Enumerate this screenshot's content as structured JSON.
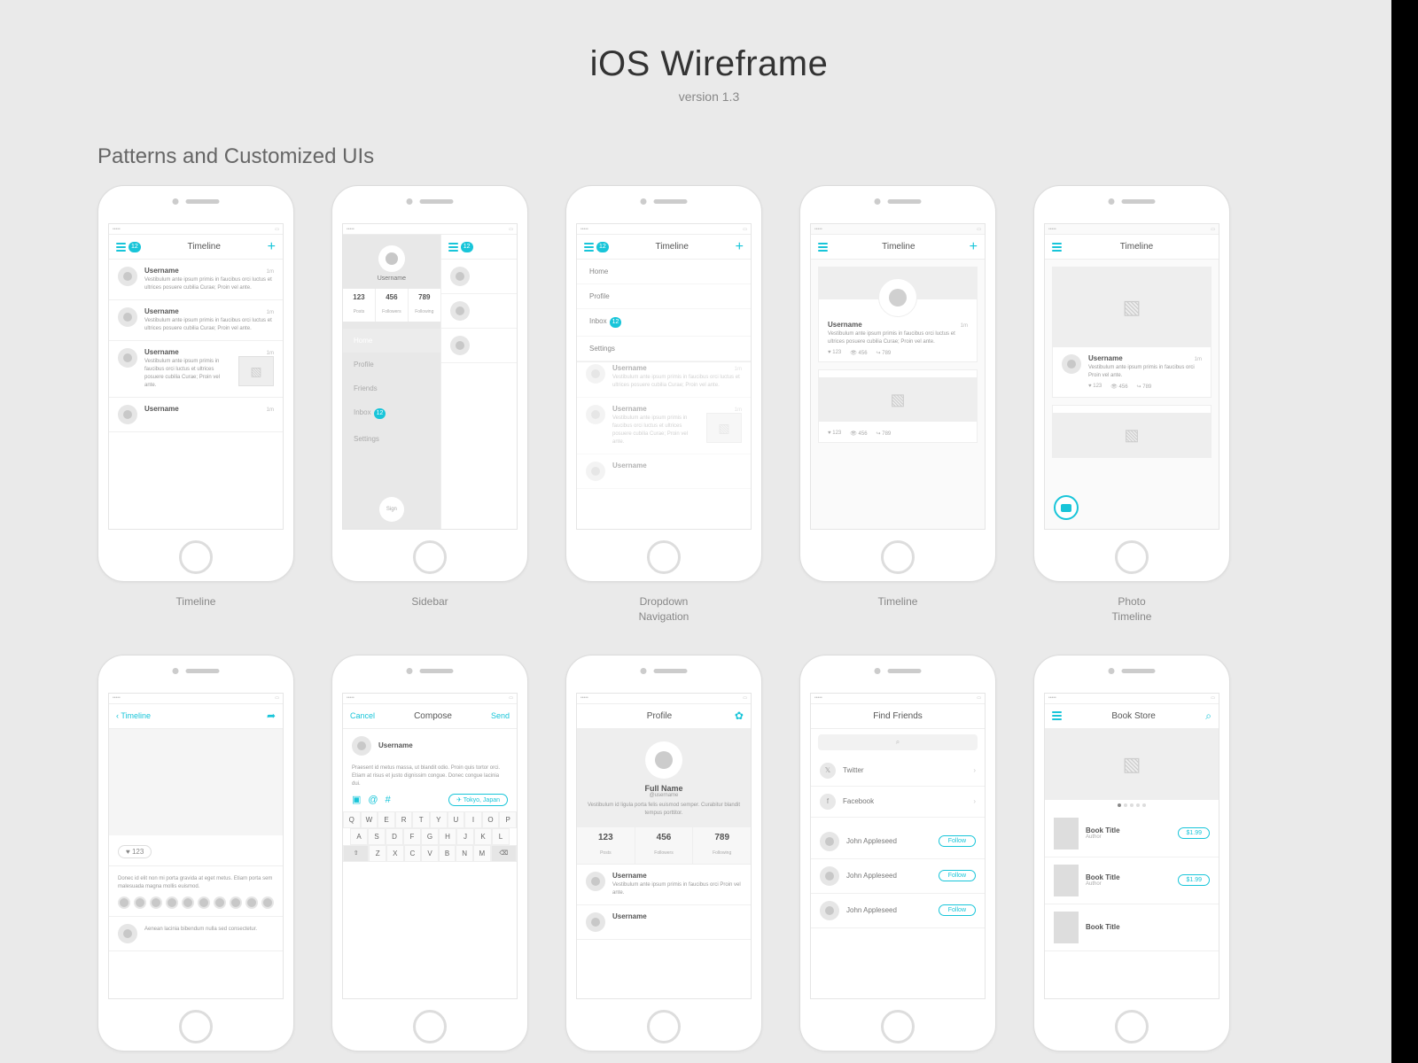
{
  "header": {
    "title": "iOS Wireframe",
    "version": "version 1.3",
    "section": "Patterns and Customized UIs"
  },
  "captions": [
    "Timeline",
    "Sidebar",
    "Dropdown\nNavigation",
    "Timeline",
    "Photo\nTimeline"
  ],
  "nav": {
    "timeline": "Timeline",
    "compose": "Compose",
    "profile": "Profile",
    "findfriends": "Find Friends",
    "bookstore": "Book Store",
    "cancel": "Cancel",
    "send": "Send",
    "searchGlyph": "⌕"
  },
  "badge": "12",
  "post": {
    "username": "Username",
    "time": "1m",
    "text": "Vestibulum ante ipsum primis in faucibus orci luctus et ultrices posuere cubilia Curae; Proin vel ante.",
    "text_short": "Vestibulum ante ipsum primis in faucibus orci Proin vel ante."
  },
  "sidebar": {
    "stats": [
      {
        "n": "123",
        "l": "Posts"
      },
      {
        "n": "456",
        "l": "Followers"
      },
      {
        "n": "789",
        "l": "Following"
      }
    ],
    "items": [
      "Home",
      "Profile",
      "Friends",
      "Inbox",
      "Settings"
    ],
    "inbox_badge": "12",
    "logout": "Sign"
  },
  "dropdown": {
    "items": [
      "Home",
      "Profile",
      "Inbox",
      "Settings"
    ],
    "inbox_badge": "12"
  },
  "card_stats": [
    "♥ 123",
    "👁 456",
    "↪ 789"
  ],
  "detail": {
    "back": "Timeline",
    "likes": "♥ 123",
    "comment1": "Donec id elit non mi porta gravida at eget metus. Etiam porta sem malesuada magna mollis euismod.",
    "comment2": "Aenean lacinia bibendum nulla sed consectetur.",
    "author2": "Username"
  },
  "compose": {
    "username": "Username",
    "text": "Praesent id metus massa, ut blandit odio. Proin quis tortor orci. Etiam at risus et justo dignissim congue. Donec congue lacinia dui.",
    "loc": "✈ Tokyo, Japan",
    "kb1": [
      "Q",
      "W",
      "E",
      "R",
      "T",
      "Y",
      "U",
      "I",
      "O",
      "P"
    ],
    "kb2": [
      "A",
      "S",
      "D",
      "F",
      "G",
      "H",
      "J",
      "K",
      "L"
    ],
    "kb3": [
      "Z",
      "X",
      "C",
      "V",
      "B",
      "N",
      "M"
    ]
  },
  "profile": {
    "fullname": "Full Name",
    "handle": "@username",
    "bio": "Vestibulum id ligula porta felis euismod semper. Curabitur blandit tempus porttitor.",
    "stats": [
      {
        "n": "123",
        "l": "Posts"
      },
      {
        "n": "456",
        "l": "Followers"
      },
      {
        "n": "789",
        "l": "Following"
      }
    ]
  },
  "find": {
    "social": [
      "Twitter",
      "Facebook"
    ],
    "contact": "John Appleseed",
    "follow": "Follow"
  },
  "store": {
    "book": "Book Title",
    "author": "Author",
    "price": "$1.99"
  }
}
